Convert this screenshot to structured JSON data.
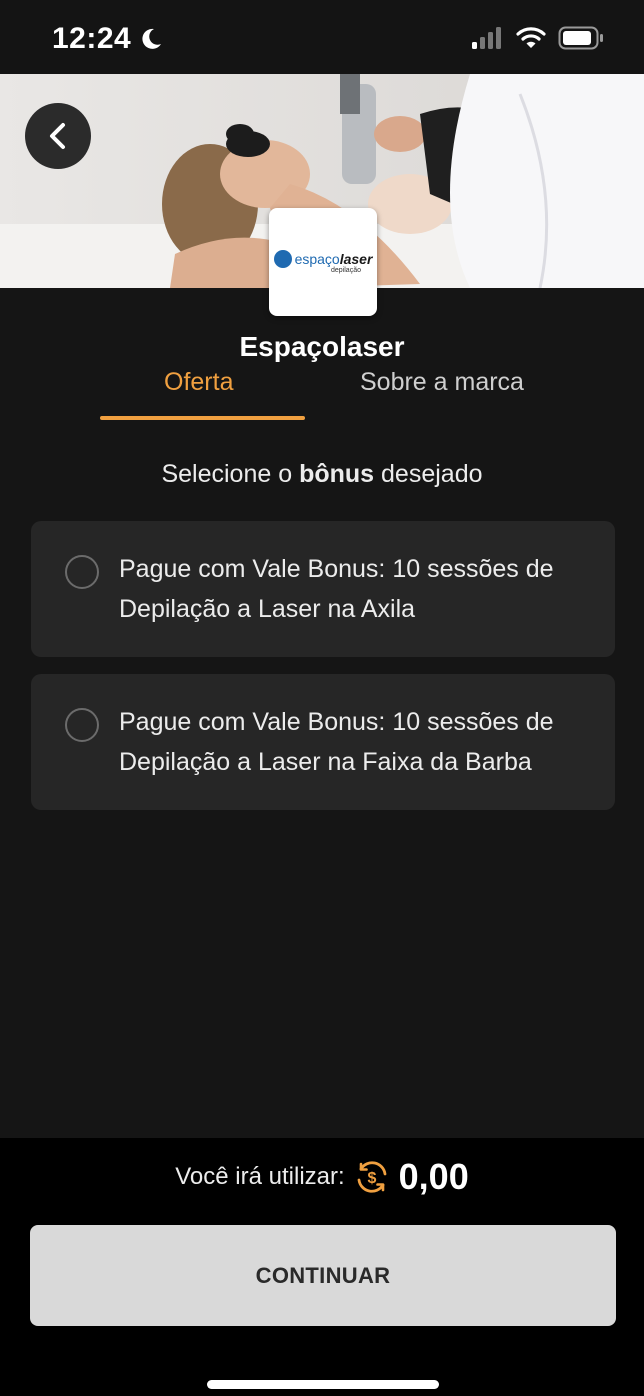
{
  "status_bar": {
    "time": "12:24"
  },
  "brand": {
    "name": "Espaçolaser",
    "logo_word_regular": "espaço",
    "logo_word_bold": "laser",
    "logo_sub": "depilação"
  },
  "tabs": [
    {
      "label": "Oferta",
      "active": true
    },
    {
      "label": "Sobre a marca",
      "active": false
    }
  ],
  "prompt": {
    "before": "Selecione o ",
    "bold": "bônus",
    "after": " desejado"
  },
  "options": [
    {
      "text": "Pague com Vale Bonus: 10 sessões de Depilação a Laser na Axila",
      "selected": false
    },
    {
      "text": "Pague com Vale Bonus: 10 sessões de Depilação a Laser na Faixa da Barba",
      "selected": false
    }
  ],
  "footer": {
    "usage_label": "Você irá utilizar:",
    "usage_amount": "0,00",
    "continue_label": "CONTINUAR"
  },
  "colors": {
    "accent": "#f0a040",
    "background": "#151515",
    "card": "#262626",
    "button": "#d9d9d9"
  },
  "icons": [
    "moon-icon",
    "signal-icon",
    "wifi-icon",
    "battery-icon",
    "back-arrow-icon",
    "coin-icon"
  ]
}
